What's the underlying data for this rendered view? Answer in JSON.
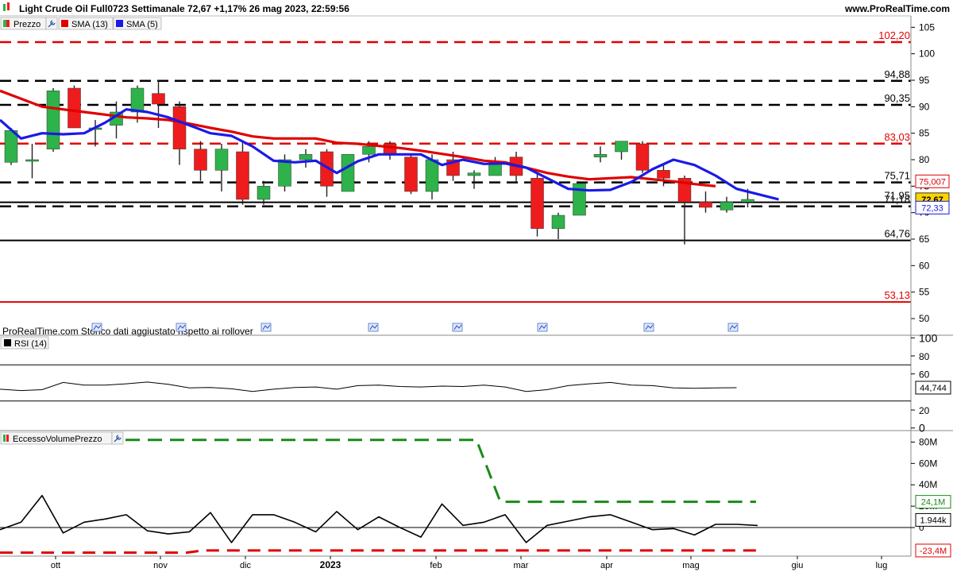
{
  "header": {
    "symbol_info": "Light Crude Oil Full0723 Settimanale 72,67 +1,17% 26 mag 2023, 22:59:56",
    "site": "www.ProRealTime.com"
  },
  "legend_price": [
    {
      "label": "Prezzo",
      "color": "#2ca02c"
    },
    {
      "label": "SMA (13)",
      "color": "#e00000"
    },
    {
      "label": "SMA (5)",
      "color": "#0000e0"
    }
  ],
  "footer_note": "ProRealTime.com  Storico dati aggiustato rispetto ai rollover",
  "rsi_panel": {
    "label": "RSI (14)",
    "last_tag": "44,744"
  },
  "volume_panel": {
    "label": "EccessoVolumePrezzo",
    "tags": [
      "24,1M",
      "1.944k",
      "-23,4M"
    ]
  },
  "colors": {
    "up": "#2db34a",
    "down": "#ee1c1c",
    "sma13": "#e00000",
    "sma5": "#1a1ae6",
    "green_dash": "#1a8a1a",
    "tag_price": "#ffd400"
  },
  "chart_data": [
    {
      "type": "candlestick",
      "title": "Light Crude Oil Full0723 Settimanale",
      "x_tick_labels": [
        "ott",
        "nov",
        "dic",
        "2023",
        "feb",
        "mar",
        "apr",
        "mag",
        "giu",
        "lug"
      ],
      "y_ticks": [
        50,
        55,
        60,
        65,
        70,
        75,
        80,
        85,
        90,
        95,
        100,
        105
      ],
      "ylim": [
        47,
        107
      ],
      "candles": [
        {
          "o": 79.5,
          "h": 86,
          "l": 79,
          "c": 85.5
        },
        {
          "o": 80,
          "h": 83,
          "l": 76.5,
          "c": 80
        },
        {
          "o": 82,
          "h": 93.5,
          "l": 81.5,
          "c": 93
        },
        {
          "o": 93.5,
          "h": 94,
          "l": 86,
          "c": 86
        },
        {
          "o": 86,
          "h": 87.5,
          "l": 82.5,
          "c": 86
        },
        {
          "o": 86.5,
          "h": 91,
          "l": 84,
          "c": 89
        },
        {
          "o": 89,
          "h": 94,
          "l": 87,
          "c": 93.5
        },
        {
          "o": 92.5,
          "h": 95,
          "l": 86,
          "c": 90.5
        },
        {
          "o": 90,
          "h": 91,
          "l": 79,
          "c": 82
        },
        {
          "o": 82,
          "h": 83.5,
          "l": 76,
          "c": 78
        },
        {
          "o": 78,
          "h": 83,
          "l": 74,
          "c": 82
        },
        {
          "o": 81.5,
          "h": 83.5,
          "l": 71.5,
          "c": 72.5
        },
        {
          "o": 72.5,
          "h": 76,
          "l": 71.5,
          "c": 75
        },
        {
          "o": 75,
          "h": 81,
          "l": 74,
          "c": 80
        },
        {
          "o": 80,
          "h": 82,
          "l": 78.5,
          "c": 81
        },
        {
          "o": 81.5,
          "h": 82,
          "l": 73,
          "c": 75
        },
        {
          "o": 74,
          "h": 81,
          "l": 74,
          "c": 81
        },
        {
          "o": 81,
          "h": 83.5,
          "l": 79.5,
          "c": 82.5
        },
        {
          "o": 83,
          "h": 83.5,
          "l": 80,
          "c": 81
        },
        {
          "o": 80.5,
          "h": 81,
          "l": 73.5,
          "c": 74
        },
        {
          "o": 74,
          "h": 81,
          "l": 72.5,
          "c": 80
        },
        {
          "o": 80,
          "h": 81.5,
          "l": 76,
          "c": 77
        },
        {
          "o": 77,
          "h": 78,
          "l": 74.5,
          "c": 77.5
        },
        {
          "o": 77,
          "h": 80.5,
          "l": 77,
          "c": 79.5
        },
        {
          "o": 80.5,
          "h": 81.5,
          "l": 75.5,
          "c": 77
        },
        {
          "o": 76.5,
          "h": 77.5,
          "l": 65.5,
          "c": 67
        },
        {
          "o": 67,
          "h": 70,
          "l": 65,
          "c": 69.5
        },
        {
          "o": 69.5,
          "h": 75.5,
          "l": 69.5,
          "c": 75.5
        },
        {
          "o": 80.5,
          "h": 82.5,
          "l": 79.5,
          "c": 81
        },
        {
          "o": 81.5,
          "h": 83.5,
          "l": 80,
          "c": 83.5
        },
        {
          "o": 83,
          "h": 83.5,
          "l": 77.5,
          "c": 78
        },
        {
          "o": 78,
          "h": 79,
          "l": 75,
          "c": 76.5
        },
        {
          "o": 76.5,
          "h": 77,
          "l": 64,
          "c": 72
        },
        {
          "o": 72,
          "h": 74,
          "l": 70,
          "c": 71
        },
        {
          "o": 70.5,
          "h": 73,
          "l": 70,
          "c": 72
        },
        {
          "o": 72,
          "h": 74.5,
          "l": 71,
          "c": 72.5
        }
      ],
      "series": [
        {
          "name": "SMA (13)",
          "values": [
            93,
            91.5,
            90,
            89.5,
            89,
            88.5,
            88,
            87.8,
            87.5,
            86.8,
            86,
            85.3,
            84.4,
            84,
            84,
            84,
            83.2,
            83,
            82.6,
            82.2,
            81.7,
            81.1,
            80.5,
            79.8,
            79.5,
            78.5,
            77.5,
            76.8,
            76.3,
            76.5,
            76.7,
            76.3,
            75.9,
            75.4,
            75.007
          ]
        },
        {
          "name": "SMA (5)",
          "values": [
            87.5,
            84,
            85,
            84.8,
            85,
            87,
            89.5,
            89,
            88,
            86.5,
            85,
            84.5,
            82.5,
            79.8,
            79.5,
            79.8,
            77.5,
            79.7,
            81,
            81,
            81,
            79,
            80,
            79.2,
            79.3,
            78.5,
            76.5,
            74.5,
            74.2,
            74.3,
            75.8,
            78.2,
            80,
            79,
            77,
            74.5,
            73.5,
            72.5
          ]
        },
        {
          "name": "RSI (14)",
          "values": [
            43,
            41.5,
            42.5,
            50.5,
            47.5,
            47.5,
            49,
            51,
            48.5,
            44.5,
            45,
            43.5,
            40.5,
            43,
            45,
            45.5,
            43,
            47,
            47.5,
            46,
            45.5,
            46.5,
            46,
            47.5,
            45.5,
            40.5,
            42.5,
            47,
            49,
            50.5,
            47.5,
            47,
            44.5,
            44,
            44.5,
            44.744
          ]
        },
        {
          "name": "EccessoVolumePrezzo",
          "values": [
            -2,
            5,
            30,
            -5,
            5,
            8,
            12,
            -3,
            -6,
            -4,
            14,
            -14,
            12,
            12,
            5,
            -4,
            15,
            -2,
            10,
            0,
            -9,
            22,
            2,
            5,
            12,
            -14,
            2,
            6,
            10,
            12,
            5,
            -2,
            -1,
            -7,
            3,
            3,
            1.944
          ]
        }
      ],
      "levels": [
        {
          "value": 102.2,
          "label": "102,20",
          "style": "red-dash"
        },
        {
          "value": 94.88,
          "label": "94,88",
          "style": "black-dash"
        },
        {
          "value": 90.35,
          "label": "90,35",
          "style": "black-dash"
        },
        {
          "value": 83.03,
          "label": "83,03",
          "style": "red-dash"
        },
        {
          "value": 75.71,
          "label": "75,71",
          "style": "black-dash"
        },
        {
          "value": 71.95,
          "label": "71,95",
          "style": "black-solid"
        },
        {
          "value": 71.19,
          "label": "71,18",
          "style": "black-dash"
        },
        {
          "value": 64.76,
          "label": "64,76",
          "style": "black-solid"
        },
        {
          "value": 53.13,
          "label": "53,13",
          "style": "red-solid"
        }
      ],
      "price_tags": [
        {
          "value": 75.007,
          "label": "75,007",
          "style": "red"
        },
        {
          "value": 72.67,
          "label": "72,67",
          "style": "yellow"
        },
        {
          "value": 72.3,
          "label": "72,33",
          "style": "blue"
        }
      ],
      "rsi": {
        "y_ticks": [
          0,
          20,
          60,
          80,
          100
        ],
        "ylim": [
          -2,
          102
        ],
        "band": [
          30,
          70
        ]
      },
      "volume": {
        "y_ticks": [
          "80M",
          "60M",
          "40M",
          "20M",
          "0"
        ],
        "tick_values": [
          80,
          60,
          40,
          20,
          0
        ],
        "ylim": [
          -26,
          90
        ],
        "upper_band": {
          "value_before": 82,
          "value_after": 24.1
        },
        "lower_band": {
          "value_before": -23.5,
          "value_after": -21.5
        }
      },
      "grid": false,
      "legend": "top-left"
    }
  ]
}
